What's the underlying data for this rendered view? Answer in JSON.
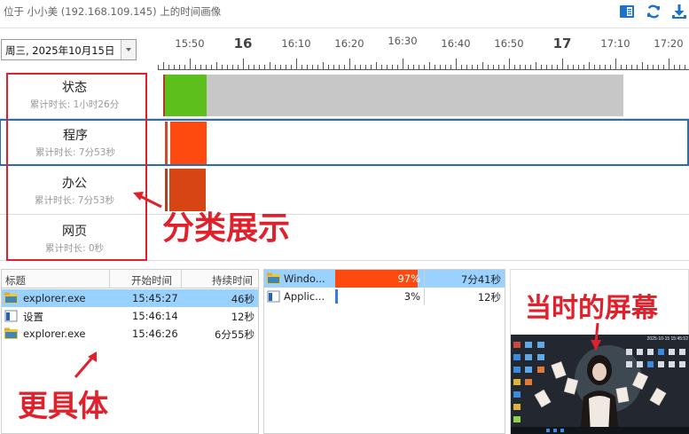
{
  "window": {
    "title": "位于 小小美 (192.168.109.145) 上的时间画像"
  },
  "toolbar": {
    "icons": [
      "book-icon",
      "refresh-icon",
      "download-icon"
    ],
    "accent": "#1a73c8"
  },
  "date_selector": {
    "value": "周三, 2025年10月15日"
  },
  "timeline": {
    "ticks": [
      "15:50",
      "16",
      "16:10",
      "16:20",
      "16:30",
      "16:40",
      "16:50",
      "17",
      "17:10",
      "17:20"
    ]
  },
  "categories": [
    {
      "name": "状态",
      "duration": "累计时长: 1小时26分",
      "color": "#5cbf1c",
      "bg": "#c7c7c7"
    },
    {
      "name": "程序",
      "duration": "累计时长: 7分53秒",
      "color": "#ff4a0f"
    },
    {
      "name": "办公",
      "duration": "累计时长: 7分53秒",
      "color": "#d64513"
    },
    {
      "name": "网页",
      "duration": "累计时长: 0秒"
    }
  ],
  "detail_table": {
    "headers": [
      "标题",
      "开始时间",
      "持续时间"
    ],
    "rows": [
      {
        "title": "explorer.exe",
        "start": "15:45:27",
        "duration": "46秒",
        "icon": "folder-icon"
      },
      {
        "title": "设置",
        "start": "15:46:14",
        "duration": "12秒",
        "icon": "window-icon"
      },
      {
        "title": "explorer.exe",
        "start": "15:46:26",
        "duration": "6分55秒",
        "icon": "folder-icon"
      }
    ]
  },
  "app_table": {
    "rows": [
      {
        "name": "Windo...",
        "percent": "97%",
        "percent_value": 97,
        "duration": "7分41秒",
        "icon": "folder-icon"
      },
      {
        "name": "Applic...",
        "percent": "3%",
        "percent_value": 3,
        "duration": "12秒",
        "icon": "window-icon"
      }
    ]
  },
  "screenshot_preview": {
    "timestamp": "2025-10-15 15:45:52"
  },
  "annotations": {
    "categories": "分类展示",
    "details": "更具体",
    "screen": "当时的屏幕"
  }
}
